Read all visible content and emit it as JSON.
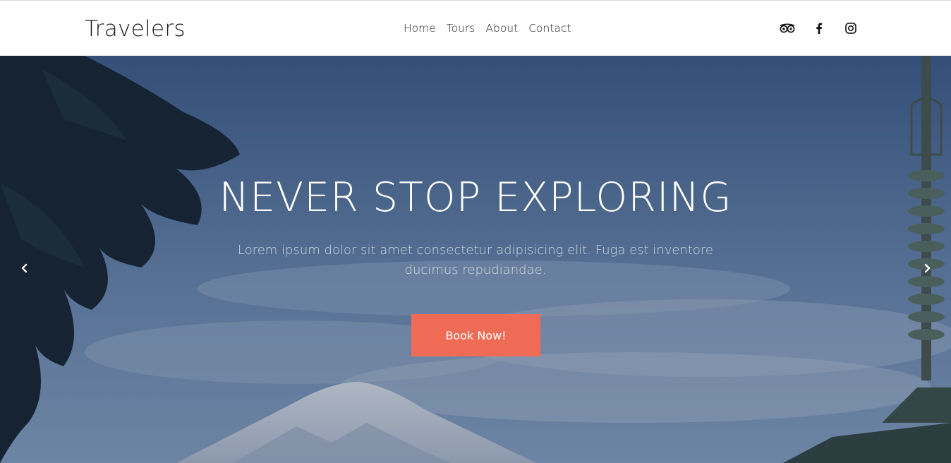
{
  "brand": "Travelers",
  "nav": {
    "items": [
      {
        "label": "Home"
      },
      {
        "label": "Tours"
      },
      {
        "label": "About"
      },
      {
        "label": "Contact"
      }
    ]
  },
  "social": [
    "tripadvisor-icon",
    "facebook-icon",
    "instagram-icon"
  ],
  "hero": {
    "title": "NEVER STOP EXPLORING",
    "text": "Lorem ipsum dolor sit amet consectetur adipisicing elit. Fuga est inventore ducimus repudiandae.",
    "button": "Book Now!",
    "prev_icon": "chevron-left-icon",
    "next_icon": "chevron-right-icon"
  },
  "colors": {
    "accent": "#f06b55",
    "sky": "#4f6f98",
    "nav_bg": "#ffffff"
  }
}
